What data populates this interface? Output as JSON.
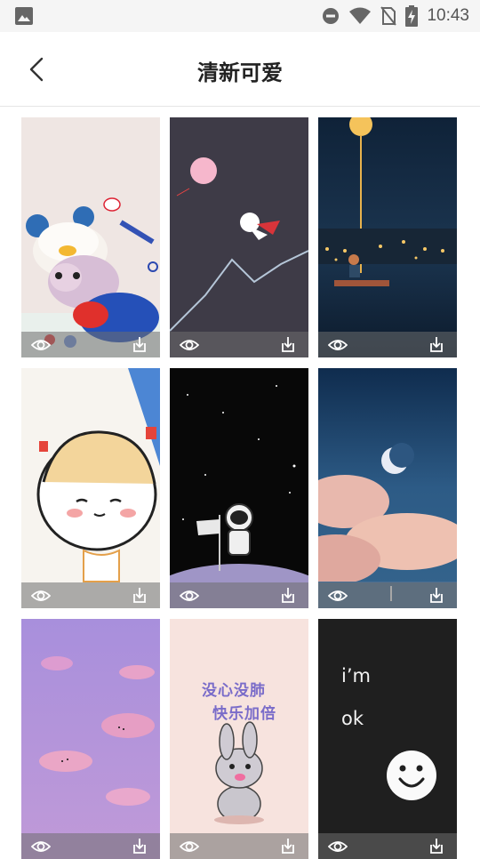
{
  "status_bar": {
    "time": "10:43",
    "icons": [
      "gallery-icon",
      "dnd-icon",
      "wifi-icon",
      "no-sim-icon",
      "battery-charging-icon"
    ]
  },
  "header": {
    "title": "清新可爱",
    "back_icon": "chevron-left-icon"
  },
  "wallpapers": [
    {
      "name": "plush-bear-duck-hat"
    },
    {
      "name": "astronaut-flying-night"
    },
    {
      "name": "rainy-city-night"
    },
    {
      "name": "cartoon-girl-sketch"
    },
    {
      "name": "astronaut-moon-flag"
    },
    {
      "name": "crescent-moon-clouds"
    },
    {
      "name": "pink-sky-clouds"
    },
    {
      "name": "bunny-text",
      "text_line1": "没心没肺",
      "text_line2": "快乐加倍"
    },
    {
      "name": "smiley-im-ok",
      "text_line1": "i’m",
      "text_line2": "ok"
    }
  ],
  "card_actions": {
    "preview_icon": "eye-icon",
    "download_icon": "download-icon"
  },
  "colors": {
    "title": "#222222",
    "bar_overlay": "#6e6e6e"
  }
}
